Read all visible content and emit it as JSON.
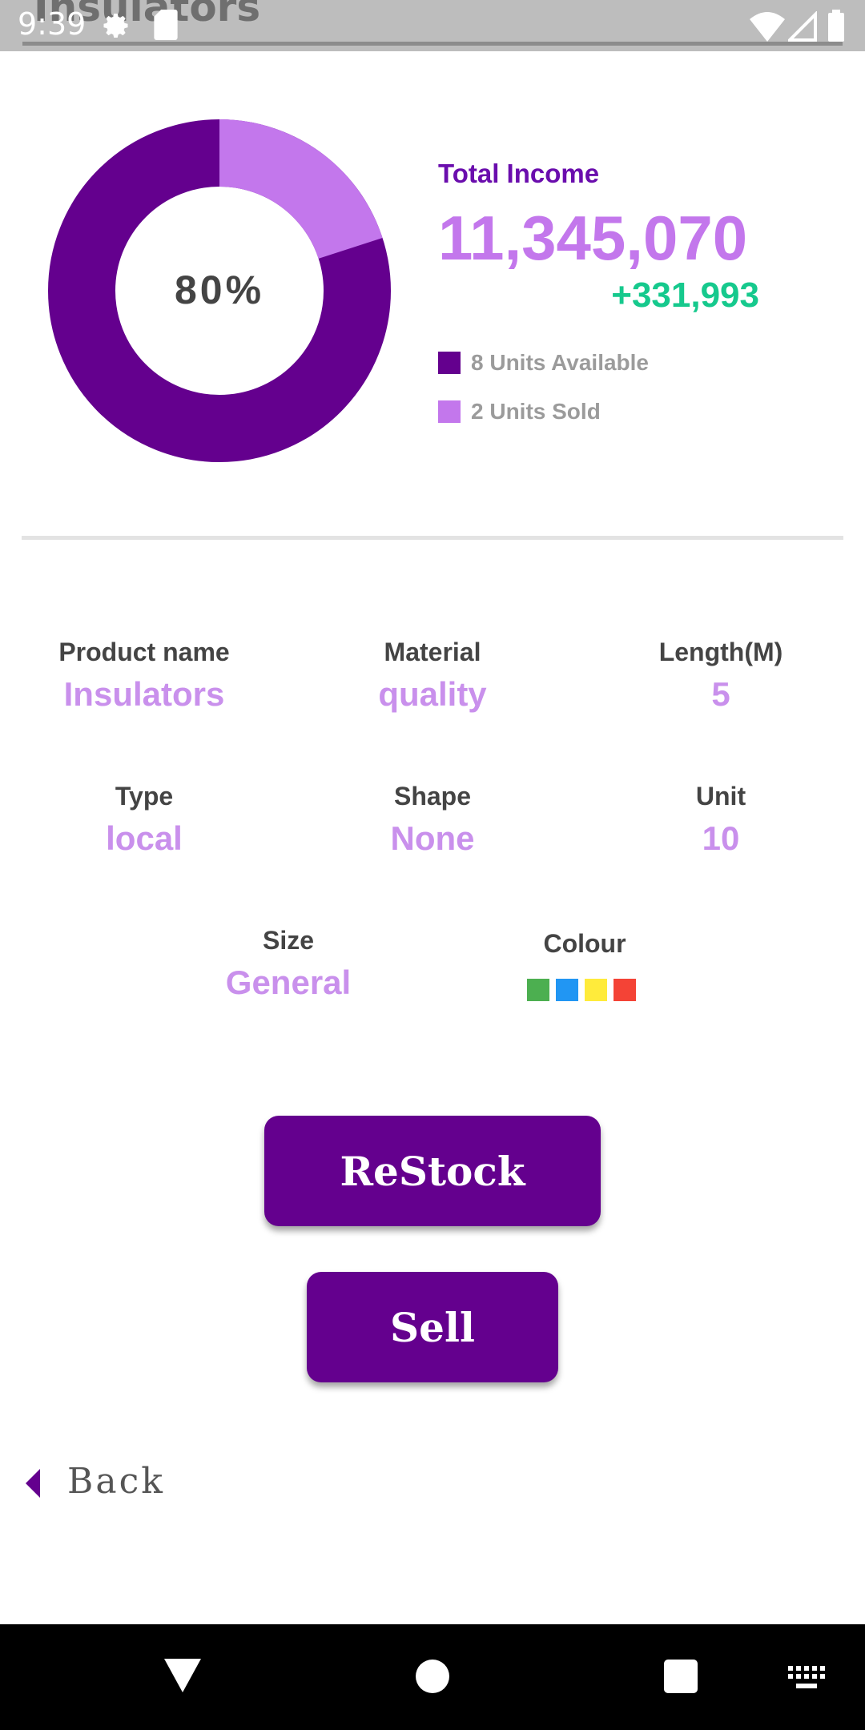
{
  "status_bar": {
    "time": "9:39",
    "title": "Insulators"
  },
  "summary": {
    "donut_percent_label": "80%",
    "available_fraction": 0.8,
    "sold_fraction": 0.2,
    "total_income_label": "Total Income",
    "total_income_value": "11,345,070",
    "income_delta": "+331,993",
    "legend": [
      {
        "label": "8 Units Available",
        "color": "#64008e"
      },
      {
        "label": "2 Units Sold",
        "color": "#c377ec"
      }
    ]
  },
  "details": {
    "product_name": {
      "label": "Product name",
      "value": "Insulators"
    },
    "material": {
      "label": "Material",
      "value": "quality"
    },
    "length": {
      "label": "Length(M)",
      "value": "5"
    },
    "type": {
      "label": "Type",
      "value": "local"
    },
    "shape": {
      "label": "Shape",
      "value": "None"
    },
    "unit": {
      "label": "Unit",
      "value": "10"
    },
    "size": {
      "label": "Size",
      "value": "General"
    },
    "colour": {
      "label": "Colour",
      "swatches": [
        "#4caf50",
        "#2196f3",
        "#ffeb3b",
        "#f44336"
      ]
    }
  },
  "actions": {
    "restock_label": "ReStock",
    "sell_label": "Sell",
    "back_label": "Back"
  },
  "colors": {
    "primary": "#64008e",
    "accent": "#c377ec",
    "positive": "#16c98d"
  },
  "icons": {
    "status": [
      "gear-icon",
      "sd-card-icon",
      "wifi-icon",
      "signal-icon",
      "battery-icon"
    ],
    "nav": [
      "back-triangle-icon",
      "home-circle-icon",
      "recents-square-icon",
      "keyboard-icon"
    ]
  }
}
